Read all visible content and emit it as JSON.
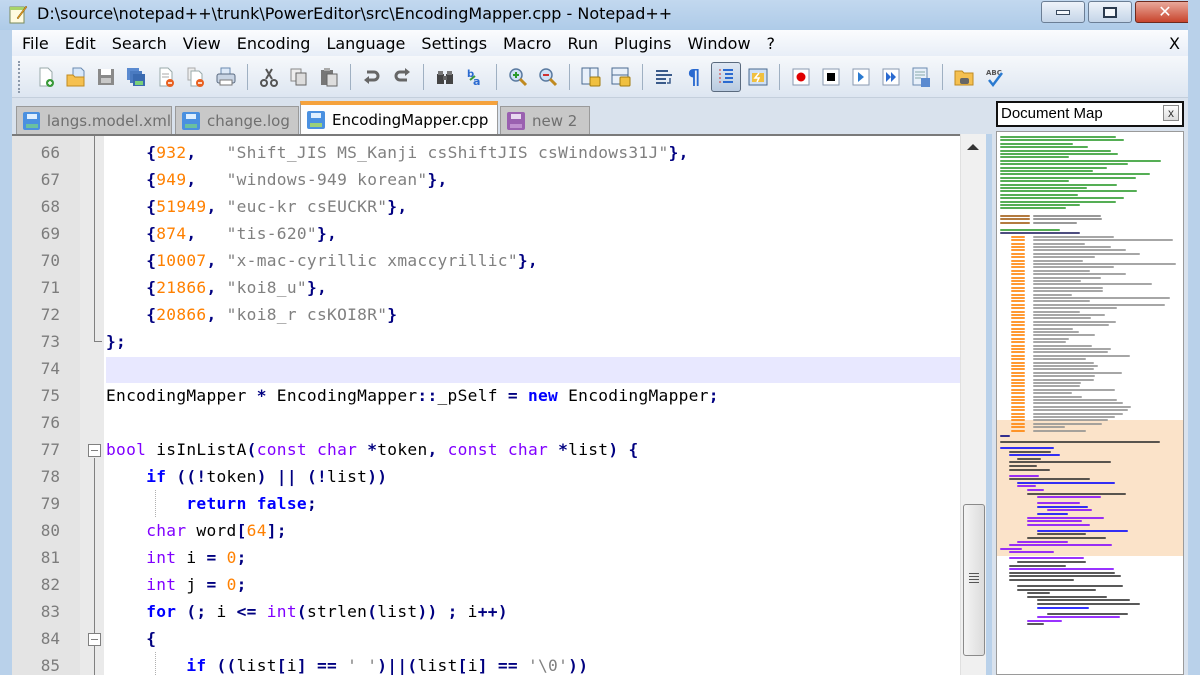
{
  "window": {
    "title": "D:\\source\\notepad++\\trunk\\PowerEditor\\src\\EncodingMapper.cpp - Notepad++",
    "minimize_glyph": "▬",
    "maximize_glyph": "▭",
    "close_glyph": "✕"
  },
  "menu": {
    "items": [
      "File",
      "Edit",
      "Search",
      "View",
      "Encoding",
      "Language",
      "Settings",
      "Macro",
      "Run",
      "Plugins",
      "Window",
      "?"
    ],
    "close_label": "X"
  },
  "toolbar": {
    "buttons": [
      {
        "name": "new-file",
        "tooltip": "New"
      },
      {
        "name": "open-file",
        "tooltip": "Open"
      },
      {
        "name": "save",
        "tooltip": "Save"
      },
      {
        "name": "save-all",
        "tooltip": "Save All"
      },
      {
        "name": "close",
        "tooltip": "Close"
      },
      {
        "name": "close-all",
        "tooltip": "Close All"
      },
      {
        "name": "print",
        "tooltip": "Print"
      },
      {
        "name": "cut",
        "tooltip": "Cut"
      },
      {
        "name": "copy",
        "tooltip": "Copy"
      },
      {
        "name": "paste",
        "tooltip": "Paste"
      },
      {
        "name": "undo",
        "tooltip": "Undo"
      },
      {
        "name": "redo",
        "tooltip": "Redo"
      },
      {
        "name": "find",
        "tooltip": "Find"
      },
      {
        "name": "replace",
        "tooltip": "Replace"
      },
      {
        "name": "zoom-in",
        "tooltip": "Zoom In"
      },
      {
        "name": "zoom-out",
        "tooltip": "Zoom Out"
      },
      {
        "name": "sync-vertical",
        "tooltip": "Synchronize Vertical Scrolling"
      },
      {
        "name": "sync-horizontal",
        "tooltip": "Synchronize Horizontal Scrolling"
      },
      {
        "name": "word-wrap",
        "tooltip": "Word wrap"
      },
      {
        "name": "show-all-chars",
        "tooltip": "Show All Characters",
        "glyph": "¶"
      },
      {
        "name": "indent-guide",
        "tooltip": "Show Indent Guide",
        "active": true
      },
      {
        "name": "user-defined-lang",
        "tooltip": "User-Defined Dialogue"
      },
      {
        "name": "macro-record",
        "tooltip": "Start Recording"
      },
      {
        "name": "macro-stop",
        "tooltip": "Stop Recording"
      },
      {
        "name": "macro-play",
        "tooltip": "Playback"
      },
      {
        "name": "macro-run-multiple",
        "tooltip": "Run a Macro Multiple Times"
      },
      {
        "name": "macro-save",
        "tooltip": "Save Current Recorded Macro"
      },
      {
        "name": "plugin-folder",
        "tooltip": "Plugin"
      },
      {
        "name": "spell-check",
        "tooltip": "Spell Check",
        "glyph": "ABC"
      }
    ]
  },
  "tabs": [
    {
      "label": "langs.model.xml",
      "active": false,
      "icon": "saved-file-icon"
    },
    {
      "label": "change.log",
      "active": false,
      "icon": "saved-file-icon"
    },
    {
      "label": "EncodingMapper.cpp",
      "active": true,
      "icon": "saved-file-icon"
    },
    {
      "label": "new  2",
      "active": false,
      "icon": "unsaved-file-icon"
    }
  ],
  "document_map": {
    "title": "Document Map",
    "close_glyph": "x"
  },
  "editor": {
    "current_line": 74,
    "lines": [
      {
        "num": "66",
        "tokens": [
          [
            "",
            "    "
          ],
          [
            "o",
            "{"
          ],
          [
            "n",
            "932"
          ],
          [
            "o",
            ","
          ],
          [
            "",
            "   "
          ],
          [
            "s",
            "\"Shift_JIS MS_Kanji csShiftJIS csWindows31J\""
          ],
          [
            "o",
            "},"
          ]
        ]
      },
      {
        "num": "67",
        "tokens": [
          [
            "",
            "    "
          ],
          [
            "o",
            "{"
          ],
          [
            "n",
            "949"
          ],
          [
            "o",
            ","
          ],
          [
            "",
            "   "
          ],
          [
            "s",
            "\"windows-949 korean\""
          ],
          [
            "o",
            "},"
          ]
        ]
      },
      {
        "num": "68",
        "tokens": [
          [
            "",
            "    "
          ],
          [
            "o",
            "{"
          ],
          [
            "n",
            "51949"
          ],
          [
            "o",
            ","
          ],
          [
            "",
            " "
          ],
          [
            "s",
            "\"euc-kr csEUCKR\""
          ],
          [
            "o",
            "},"
          ]
        ]
      },
      {
        "num": "69",
        "tokens": [
          [
            "",
            "    "
          ],
          [
            "o",
            "{"
          ],
          [
            "n",
            "874"
          ],
          [
            "o",
            ","
          ],
          [
            "",
            "   "
          ],
          [
            "s",
            "\"tis-620\""
          ],
          [
            "o",
            "},"
          ]
        ]
      },
      {
        "num": "70",
        "tokens": [
          [
            "",
            "    "
          ],
          [
            "o",
            "{"
          ],
          [
            "n",
            "10007"
          ],
          [
            "o",
            ","
          ],
          [
            "",
            " "
          ],
          [
            "s",
            "\"x-mac-cyrillic xmaccyrillic\""
          ],
          [
            "o",
            "},"
          ]
        ]
      },
      {
        "num": "71",
        "tokens": [
          [
            "",
            "    "
          ],
          [
            "o",
            "{"
          ],
          [
            "n",
            "21866"
          ],
          [
            "o",
            ","
          ],
          [
            "",
            " "
          ],
          [
            "s",
            "\"koi8_u\""
          ],
          [
            "o",
            "},"
          ]
        ]
      },
      {
        "num": "72",
        "tokens": [
          [
            "",
            "    "
          ],
          [
            "o",
            "{"
          ],
          [
            "n",
            "20866"
          ],
          [
            "o",
            ","
          ],
          [
            "",
            " "
          ],
          [
            "s",
            "\"koi8_r csKOI8R\""
          ],
          [
            "o",
            "}"
          ]
        ]
      },
      {
        "num": "73",
        "tokens": [
          [
            "o",
            "};"
          ]
        ]
      },
      {
        "num": "74",
        "tokens": []
      },
      {
        "num": "75",
        "tokens": [
          [
            "",
            "EncodingMapper "
          ],
          [
            "o",
            "*"
          ],
          [
            "",
            " EncodingMapper"
          ],
          [
            "o",
            "::"
          ],
          [
            "",
            "_pSelf "
          ],
          [
            "o",
            "="
          ],
          [
            "",
            " "
          ],
          [
            "kw",
            "new"
          ],
          [
            "",
            " EncodingMapper"
          ],
          [
            "o",
            ";"
          ]
        ]
      },
      {
        "num": "76",
        "tokens": []
      },
      {
        "num": "77",
        "tokens": [
          [
            "k",
            "bool"
          ],
          [
            "",
            " isInListA"
          ],
          [
            "o",
            "("
          ],
          [
            "k",
            "const"
          ],
          [
            "",
            " "
          ],
          [
            "k",
            "char"
          ],
          [
            "",
            " "
          ],
          [
            "o",
            "*"
          ],
          [
            "",
            "token"
          ],
          [
            "o",
            ","
          ],
          [
            "",
            " "
          ],
          [
            "k",
            "const"
          ],
          [
            "",
            " "
          ],
          [
            "k",
            "char"
          ],
          [
            "",
            " "
          ],
          [
            "o",
            "*"
          ],
          [
            "",
            "list"
          ],
          [
            "o",
            ")"
          ],
          [
            "",
            " "
          ],
          [
            "o",
            "{"
          ]
        ]
      },
      {
        "num": "78",
        "tokens": [
          [
            "",
            "    "
          ],
          [
            "kw",
            "if"
          ],
          [
            "",
            " "
          ],
          [
            "o",
            "((!"
          ],
          [
            "",
            "token"
          ],
          [
            "o",
            ")"
          ],
          [
            "",
            " "
          ],
          [
            "o",
            "||"
          ],
          [
            "",
            " "
          ],
          [
            "o",
            "(!"
          ],
          [
            "",
            "list"
          ],
          [
            "o",
            "))"
          ]
        ]
      },
      {
        "num": "79",
        "tokens": [
          [
            "",
            "        "
          ],
          [
            "kw",
            "return"
          ],
          [
            "",
            " "
          ],
          [
            "kw",
            "false"
          ],
          [
            "o",
            ";"
          ]
        ]
      },
      {
        "num": "80",
        "tokens": [
          [
            "",
            "    "
          ],
          [
            "k",
            "char"
          ],
          [
            "",
            " word"
          ],
          [
            "o",
            "["
          ],
          [
            "n",
            "64"
          ],
          [
            "o",
            "];"
          ]
        ]
      },
      {
        "num": "81",
        "tokens": [
          [
            "",
            "    "
          ],
          [
            "k",
            "int"
          ],
          [
            "",
            " i "
          ],
          [
            "o",
            "="
          ],
          [
            "",
            " "
          ],
          [
            "n",
            "0"
          ],
          [
            "o",
            ";"
          ]
        ]
      },
      {
        "num": "82",
        "tokens": [
          [
            "",
            "    "
          ],
          [
            "k",
            "int"
          ],
          [
            "",
            " j "
          ],
          [
            "o",
            "="
          ],
          [
            "",
            " "
          ],
          [
            "n",
            "0"
          ],
          [
            "o",
            ";"
          ]
        ]
      },
      {
        "num": "83",
        "tokens": [
          [
            "",
            "    "
          ],
          [
            "kw",
            "for"
          ],
          [
            "",
            " "
          ],
          [
            "o",
            "(;"
          ],
          [
            "",
            " i "
          ],
          [
            "o",
            "<="
          ],
          [
            "",
            " "
          ],
          [
            "k",
            "int"
          ],
          [
            "o",
            "("
          ],
          [
            "",
            "strlen"
          ],
          [
            "o",
            "("
          ],
          [
            "",
            "list"
          ],
          [
            "o",
            "))"
          ],
          [
            "",
            " "
          ],
          [
            "o",
            ";"
          ],
          [
            "",
            " i"
          ],
          [
            "o",
            "++)"
          ]
        ]
      },
      {
        "num": "84",
        "tokens": [
          [
            "",
            "    "
          ],
          [
            "o",
            "{"
          ]
        ]
      },
      {
        "num": "85",
        "tokens": [
          [
            "",
            "        "
          ],
          [
            "kw",
            "if"
          ],
          [
            "",
            " "
          ],
          [
            "o",
            "(("
          ],
          [
            "",
            "list"
          ],
          [
            "o",
            "["
          ],
          [
            "",
            "i"
          ],
          [
            "o",
            "]"
          ],
          [
            "",
            " "
          ],
          [
            "o",
            "=="
          ],
          [
            "",
            " "
          ],
          [
            "s",
            "' '"
          ],
          [
            "o",
            ")||("
          ],
          [
            "",
            "list"
          ],
          [
            "o",
            "["
          ],
          [
            "",
            "i"
          ],
          [
            "o",
            "]"
          ],
          [
            "",
            " "
          ],
          [
            "o",
            "=="
          ],
          [
            "",
            " "
          ],
          [
            "s",
            "'\\0'"
          ],
          [
            "o",
            "))"
          ]
        ]
      }
    ]
  },
  "colors": {
    "keyword_type": "#8000ff",
    "keyword_instr": "#0000ff",
    "number": "#ff8000",
    "string": "#808080",
    "operator": "#000080",
    "current_line_bg": "#e8e8ff",
    "active_tab_accent": "#f5a23c",
    "docmap_view_bg": "#fbe3c9"
  }
}
